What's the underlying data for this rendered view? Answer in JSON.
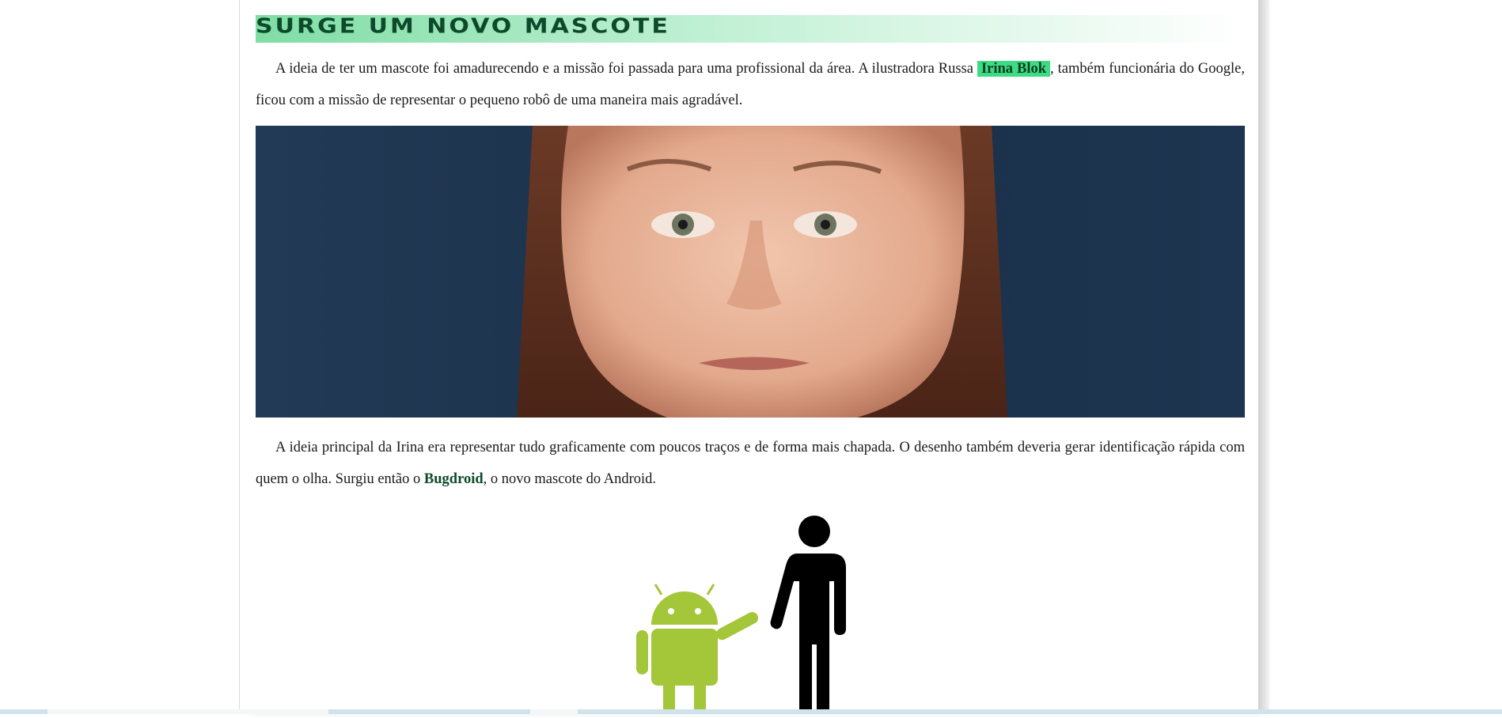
{
  "article": {
    "heading": "Surge um novo mascote",
    "paragraph1": {
      "before": "A ideia de ter um mascote foi amadurecendo e a missão foi passada para uma profissional da área. A ilustradora Russa ",
      "highlight": "Irina Blok",
      "after": ", também funcionária do Google, ficou com a missão de representar o pequeno robô de uma maneira mais agradável."
    },
    "paragraph2": {
      "before": "A ideia principal da Irina era representar tudo graficamente com poucos traços e de forma mais chapada. O desenho também deveria gerar identificação rápida com quem o olha. Surgiu então o ",
      "emphasis": "Bugdroid",
      "after": ", o novo mascote do Android."
    }
  },
  "colors": {
    "heading_text": "#0d4a2a",
    "highlight_bg": "#3ddc84",
    "android_green": "#a4c639",
    "photo_background": "#1f3550"
  }
}
